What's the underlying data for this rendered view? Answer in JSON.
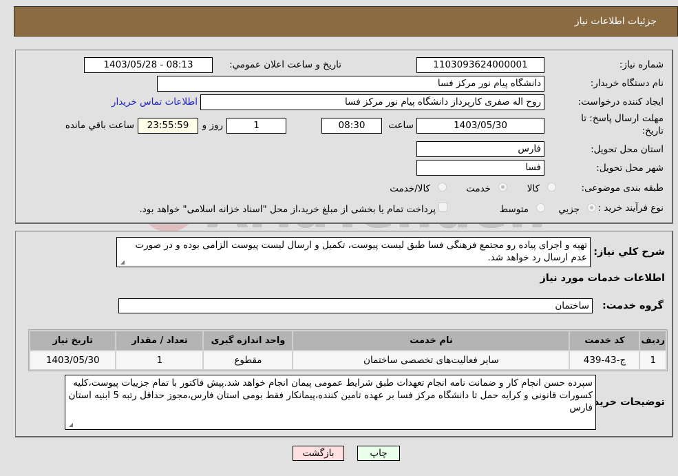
{
  "header": {
    "title": "جزئيات اطلاعات نياز"
  },
  "details": {
    "need_number_label": "شماره نياز:",
    "need_number": "1103093624000001",
    "announce_label": "تاريخ و ساعت اعلان عمومي:",
    "announce_value": "1403/05/28 - 08:13",
    "buyer_org_label": "نام دستگاه خريدار:",
    "buyer_org": "دانشگاه پیام نور مرکز فسا",
    "creator_label": "ايجاد کننده درخواست:",
    "creator": "روح اله  صفری کارپرداز دانشگاه پیام نور مرکز فسا",
    "contact_link": "اطلاعات تماس خريدار",
    "deadline_label_line1": "مهلت ارسال پاسخ: تا",
    "deadline_label_line2": "تاريخ:",
    "deadline_date": "1403/05/30",
    "time_label": "ساعت",
    "deadline_time": "08:30",
    "days_value": "1",
    "days_label": "روز و",
    "remaining_time": "23:55:59",
    "remaining_label": "ساعت باقي مانده",
    "province_label": "استان محل تحويل:",
    "province": "فارس",
    "city_label": "شهر محل تحويل:",
    "city": "فسا",
    "category_label": "طبقه بندی موضوعی:",
    "category_options": [
      {
        "label": "کالا",
        "selected": false
      },
      {
        "label": "خدمت",
        "selected": true
      },
      {
        "label": "کالا/خدمت",
        "selected": false
      }
    ],
    "process_label": "نوع فرآیند خرید :",
    "process_options": [
      {
        "label": "جزيي",
        "selected": true
      },
      {
        "label": "متوسط",
        "selected": false
      }
    ],
    "treasury_checkbox_checked": false,
    "treasury_text": "پرداخت تمام يا بخشی از مبلغ خريد،از محل \"اسناد خزانه اسلامی\" خواهد بود."
  },
  "needs": {
    "summary_label": "شرح کلي نياز:",
    "summary": "تهيه و اجرای پياده رو مجتمع فرهنگی فسا طبق ليست پيوست، تکميل و ارسال ليست پيوست الزامی بوده و در صورت عدم ارسال رد خواهد شد.",
    "services_heading": "اطلاعات خدمات مورد نياز",
    "service_group_label": "گروه خدمت:",
    "service_group": "ساختمان",
    "table": {
      "headers": [
        "رديف",
        "کد خدمت",
        "نام خدمت",
        "واحد اندازه گيری",
        "تعداد / مقدار",
        "تاريخ نياز"
      ],
      "rows": [
        [
          "1",
          "ج-43-439",
          "ساير فعاليت‌های تخصصی ساختمان",
          "مقطوع",
          "1",
          "1403/05/30"
        ]
      ]
    },
    "buyer_notes_label": "توضيحات خريدار:",
    "buyer_notes": "سپرده حسن انجام کار و ضمانت نامه انجام تعهدات طبق شرايط عمومی پيمان انجام خواهد شد.پيش فاکتور با تمام جزييات پيوست،کليه کسورات قانونی و کرايه حمل تا دانشگاه مرکز فسا بر عهده تامين کننده،پيمانکار فقط بومی استان فارس،مجوز حداقل رتبه 5 ابنيه استان فارس"
  },
  "actions": {
    "print": "چاپ",
    "back": "بازگشت"
  },
  "watermark": {
    "text": "AriaTender.neT"
  },
  "colors": {
    "header_bg": "#8b6c42",
    "link": "#2020d0",
    "print_bg": "#eaffea",
    "back_bg": "#ffe0e0"
  }
}
